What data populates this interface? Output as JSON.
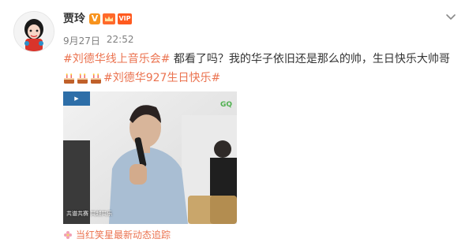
{
  "post": {
    "author": "贾玲",
    "date": "9月27日",
    "time": "22:52",
    "topic1": "#刘德华线上音乐会#",
    "text": " 都看了吗？我的华子依旧还是那么的帅，生日快乐大帅哥",
    "topic2": "#刘德华927生日快乐#",
    "cake_count": 3,
    "source": "当红笑星最新动态追踪"
  },
  "badges": {
    "v": "V",
    "vip": "VIP"
  },
  "media": {
    "logo": "GQ",
    "caption": "共谱共赛 共越共乐"
  },
  "colors": {
    "topic": "#eb7350",
    "text": "#333333",
    "meta": "#808080",
    "badge_v": "#f7931e"
  },
  "icons": [
    "avatar",
    "verified-v-icon",
    "crown-icon",
    "vip-icon",
    "chevron-down-icon",
    "cake-icon",
    "flower-icon"
  ]
}
